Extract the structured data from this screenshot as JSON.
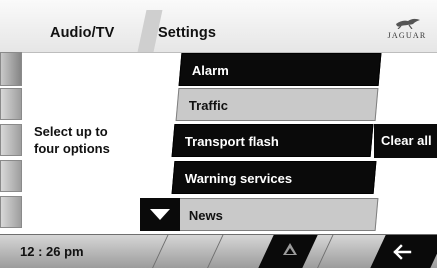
{
  "header": {
    "audio_tv_label": "Audio/TV",
    "settings_label": "Settings",
    "logo_text": "JAGUAR"
  },
  "prompt": {
    "line1": "Select up to",
    "line2": "four options"
  },
  "options": [
    {
      "label": "Alarm",
      "selected": true
    },
    {
      "label": "Traffic",
      "selected": false
    },
    {
      "label": "Transport flash",
      "selected": true
    },
    {
      "label": "Warning services",
      "selected": true
    },
    {
      "label": "News",
      "selected": false
    }
  ],
  "clear_all_label": "Clear all",
  "status": {
    "time": "12 : 26 pm"
  },
  "icons": {
    "scroll": "triangle-down-icon",
    "eject": "eject-icon",
    "back": "back-arrow-icon",
    "logo": "jaguar-leaper-icon"
  },
  "colors": {
    "selected_bg": "#0a0a0a",
    "unselected_bg": "#c9c9c9",
    "header_bg": "#eeeeee",
    "bottom_bar": "#b0b0b0"
  }
}
